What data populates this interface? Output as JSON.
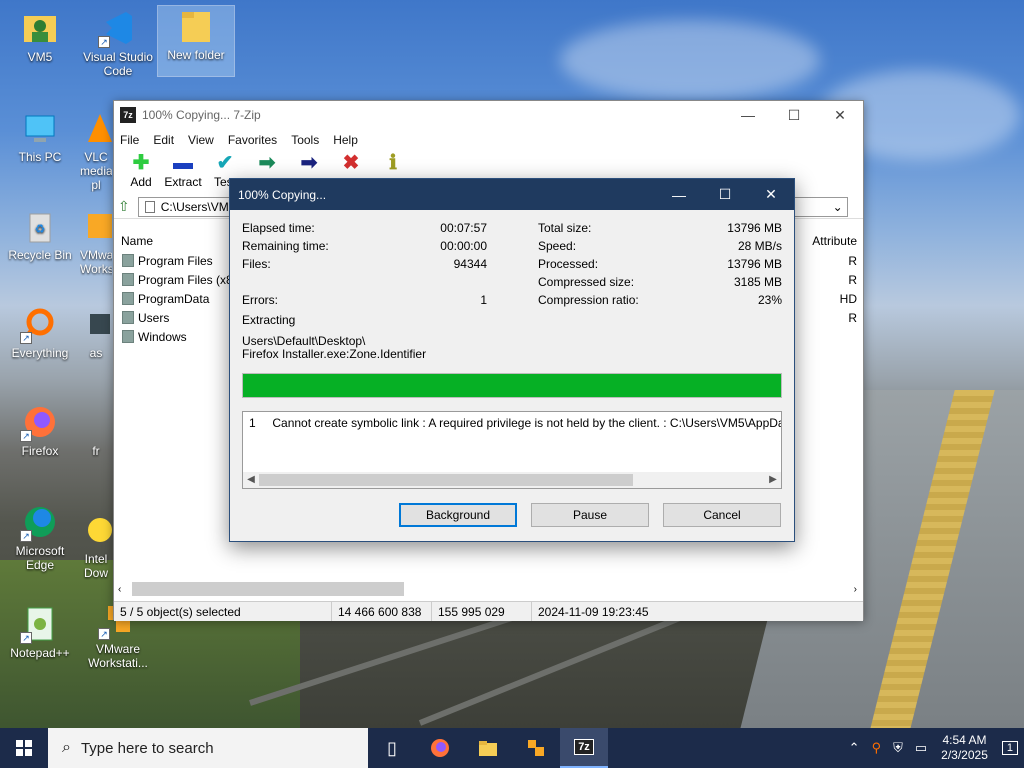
{
  "desktop": {
    "icons": [
      {
        "label": "VM5"
      },
      {
        "label": "Visual Studio Code"
      },
      {
        "label": "New folder"
      },
      {
        "label": "This PC"
      },
      {
        "label": "VLC media pl"
      },
      {
        "label": "Recycle Bin"
      },
      {
        "label": "VMware Worksta"
      },
      {
        "label": "Everything"
      },
      {
        "label": "as"
      },
      {
        "label": "Firefox"
      },
      {
        "label": "fr"
      },
      {
        "label": "Microsoft Edge"
      },
      {
        "label": "Intel Dow"
      },
      {
        "label": "Notepad++"
      },
      {
        "label": "VMware Workstati..."
      }
    ]
  },
  "main_window": {
    "title": "100% Copying... 7-Zip",
    "menu": [
      "File",
      "Edit",
      "View",
      "Favorites",
      "Tools",
      "Help"
    ],
    "toolbar": [
      "Add",
      "Extract",
      "Test",
      "",
      "",
      "",
      ""
    ],
    "address": "C:\\Users\\VM",
    "columns": {
      "name": "Name",
      "attributes": "Attribute"
    },
    "rows": [
      {
        "name": "Program Files",
        "attr": "R"
      },
      {
        "name": "Program Files (x8",
        "attr": "R"
      },
      {
        "name": "ProgramData",
        "attr": "HD"
      },
      {
        "name": "Users",
        "attr": "R"
      },
      {
        "name": "Windows",
        "attr": ""
      }
    ],
    "status": {
      "selection": "5 / 5 object(s) selected",
      "size1": "14 466 600 838",
      "size2": "155 995 029",
      "date": "2024-11-09 19:23:45"
    }
  },
  "dialog": {
    "title": "100% Copying...",
    "left": [
      {
        "label": "Elapsed time:",
        "value": "00:07:57"
      },
      {
        "label": "Remaining time:",
        "value": "00:00:00"
      },
      {
        "label": "Files:",
        "value": "94344"
      }
    ],
    "errors": {
      "label": "Errors:",
      "value": "1"
    },
    "right": [
      {
        "label": "Total size:",
        "value": "13796 MB"
      },
      {
        "label": "Speed:",
        "value": "28 MB/s"
      },
      {
        "label": "Processed:",
        "value": "13796 MB"
      },
      {
        "label": "Compressed size:",
        "value": "3185 MB"
      },
      {
        "label": "Compression ratio:",
        "value": "23%"
      }
    ],
    "operation": "Extracting",
    "path_line1": "Users\\Default\\Desktop\\",
    "path_line2": "Firefox Installer.exe:Zone.Identifier",
    "progress": 1.0,
    "log_number": "1",
    "log_message": "Cannot create symbolic link : A required privilege is not held by the client. : C:\\Users\\VM5\\AppData\\Local\\",
    "buttons": {
      "background": "Background",
      "pause": "Pause",
      "cancel": "Cancel"
    }
  },
  "taskbar": {
    "search_placeholder": "Type here to search",
    "time": "4:54 AM",
    "date": "2/3/2025",
    "notifications": "1"
  },
  "colors": {
    "progress": "#06b025",
    "dialog_title": "#1f3a5f",
    "taskbar": "#1c2b4a"
  }
}
